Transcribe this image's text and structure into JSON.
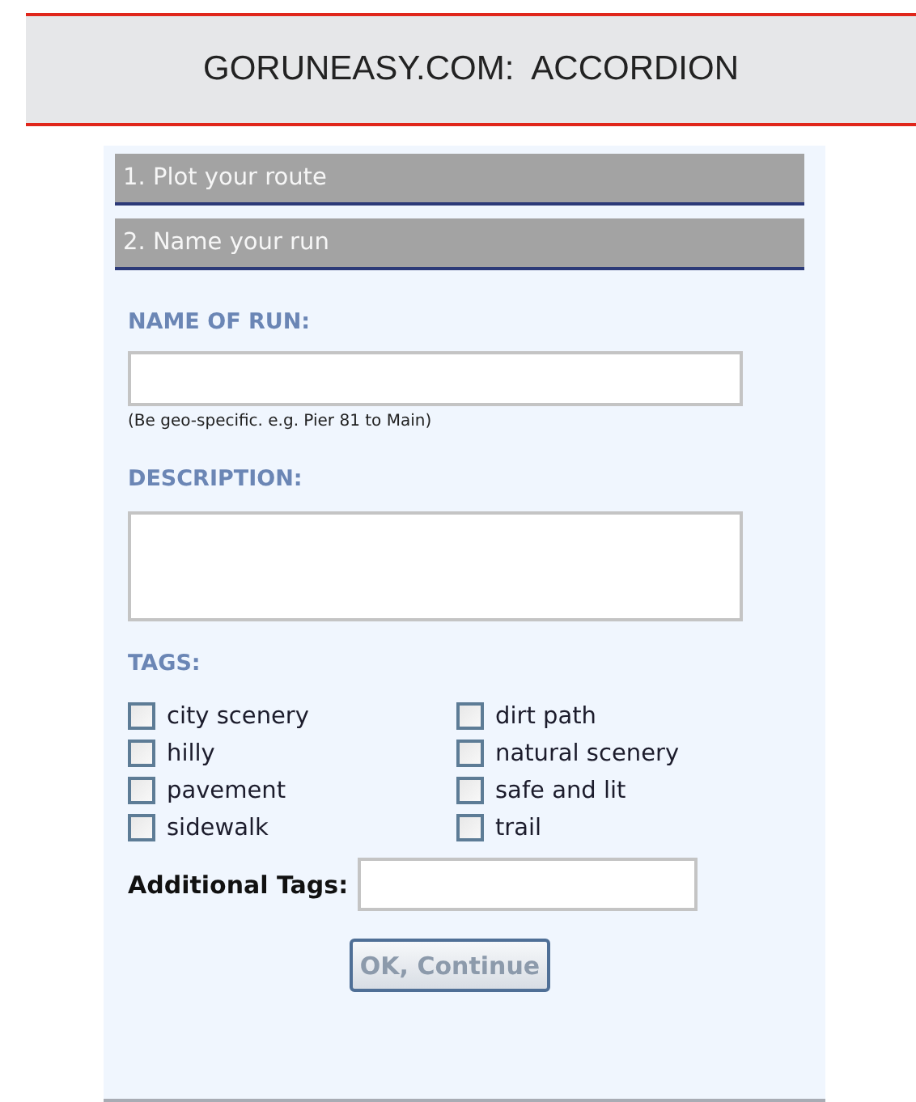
{
  "header": {
    "title": "GORUNEASY.COM:  ACCORDION"
  },
  "accordion": {
    "sections": [
      {
        "title": "1. Plot your route"
      },
      {
        "title": "2. Name your run"
      }
    ]
  },
  "form": {
    "name_label": "NAME OF RUN:",
    "name_hint": "(Be geo-specific. e.g. Pier 81 to Main)",
    "description_label": "DESCRIPTION:",
    "tags_label": "TAGS:",
    "tags": [
      {
        "label": "city scenery",
        "checked": false
      },
      {
        "label": "dirt path",
        "checked": false
      },
      {
        "label": "hilly",
        "checked": false
      },
      {
        "label": "natural scenery",
        "checked": false
      },
      {
        "label": "pavement",
        "checked": false
      },
      {
        "label": "safe and lit",
        "checked": false
      },
      {
        "label": "sidewalk",
        "checked": false
      },
      {
        "label": "trail",
        "checked": false
      }
    ],
    "additional_tags_label": "Additional Tags:",
    "submit": "OK, Continue"
  }
}
